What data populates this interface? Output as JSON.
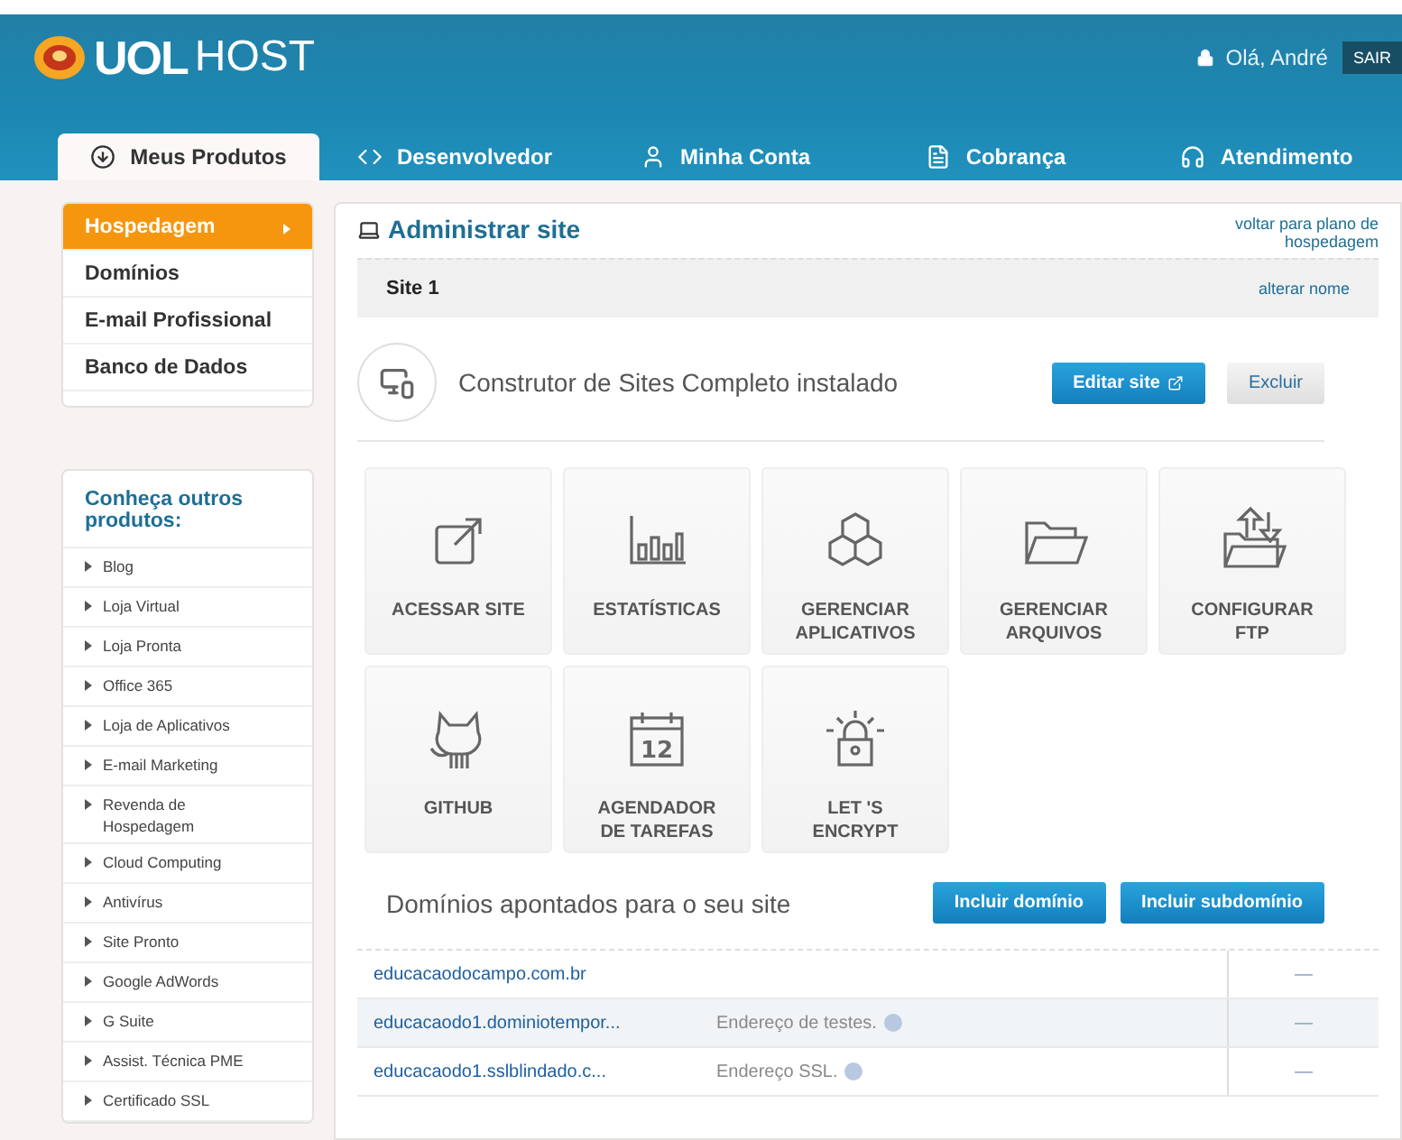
{
  "header": {
    "logo_bold": "UOL",
    "logo_light": "HOST",
    "greeting": "Olá, André",
    "logout": "SAIR"
  },
  "tabs": [
    {
      "label": "Meus Produtos",
      "kind": "products",
      "selected": true
    },
    {
      "label": "Desenvolvedor",
      "kind": "code",
      "selected": false
    },
    {
      "label": "Minha Conta",
      "kind": "user",
      "selected": false
    },
    {
      "label": "Cobrança",
      "kind": "bill",
      "selected": false
    },
    {
      "label": "Atendimento",
      "kind": "support",
      "selected": false
    }
  ],
  "sidebar": {
    "items": [
      {
        "label": "Hospedagem",
        "selected": true
      },
      {
        "label": "Domínios",
        "selected": false
      },
      {
        "label": "E-mail Profissional",
        "selected": false
      },
      {
        "label": "Banco de Dados",
        "selected": false
      }
    ],
    "others_title": "Conheça outros produtos:",
    "others": [
      "Blog",
      "Loja Virtual",
      "Loja Pronta",
      "Office 365",
      "Loja de Aplicativos",
      "E-mail Marketing",
      "Revenda de Hospedagem",
      "Cloud Computing",
      "Antivírus",
      "Site Pronto",
      "Google AdWords",
      "G Suite",
      "Assist. Técnica PME",
      "Certificado SSL"
    ]
  },
  "panel": {
    "title": "Administrar site",
    "back_link": "voltar para plano de hospedagem",
    "site_name": "Site 1",
    "rename_link": "alterar nome",
    "builder": {
      "text": "Construtor de Sites Completo instalado",
      "edit_button": "Editar site",
      "delete_button": "Excluir"
    },
    "tiles": [
      {
        "kind": "external",
        "label": "ACESSAR SITE"
      },
      {
        "kind": "chart",
        "label": "ESTATÍSTICAS"
      },
      {
        "kind": "cubes",
        "label": "GERENCIAR APLICATIVOS"
      },
      {
        "kind": "folder",
        "label": "GERENCIAR ARQUIVOS"
      },
      {
        "kind": "ftp",
        "label": "CONFIGURAR FTP"
      },
      {
        "kind": "cat",
        "label": "GITHUB"
      },
      {
        "kind": "calendar",
        "label": "AGENDADOR DE TAREFAS",
        "icon_text": "12"
      },
      {
        "kind": "lock",
        "label": "LET 'S ENCRYPT"
      }
    ],
    "domains": {
      "title": "Domínios apontados para o seu site",
      "add_domain": "Incluir domínio",
      "add_subdomain": "Incluir subdomínio",
      "rows": [
        {
          "domain": "educacaodocampo.com.br",
          "action": "—"
        },
        {
          "domain": "educacaodo1.dominiotempor...",
          "note": "Endereço de testes.",
          "action": "—"
        },
        {
          "domain": "educacaodo1.sslblindado.c...",
          "note": "Endereço SSL.",
          "action": "—"
        }
      ]
    }
  }
}
